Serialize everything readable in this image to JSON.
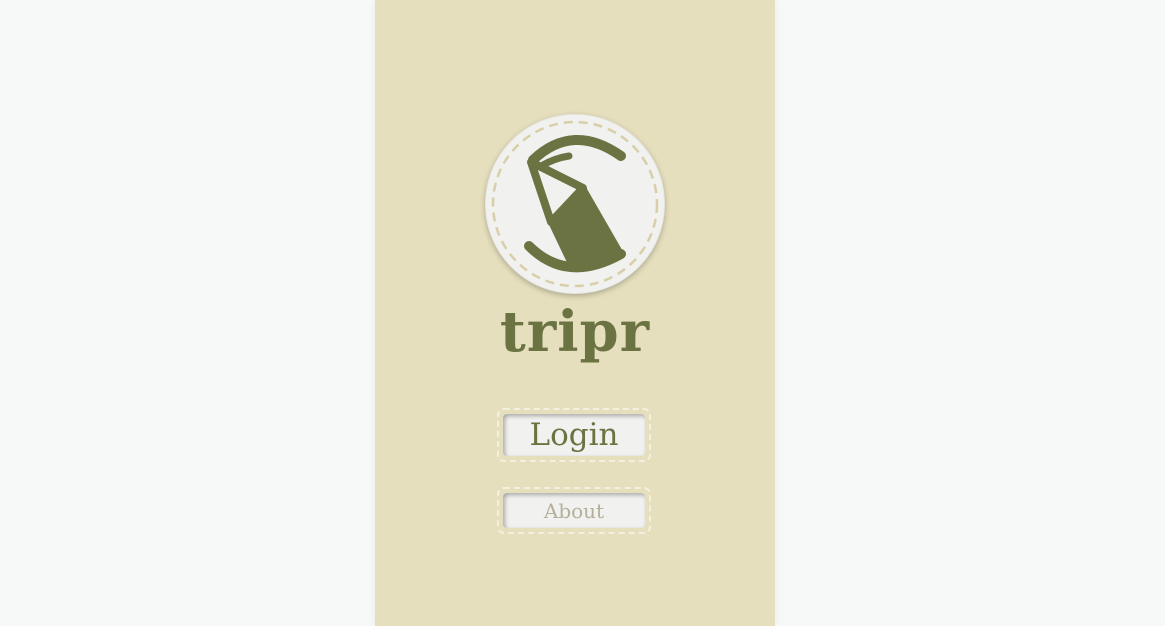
{
  "app": {
    "title": "tripr",
    "logo_icon": "folded-map-s-icon"
  },
  "buttons": {
    "login_label": "Login",
    "about_label": "About"
  },
  "colors": {
    "page_background": "#f7f8f8",
    "panel_background": "#e6dfbd",
    "brand_olive": "#6b7342",
    "badge_background": "#f1f1f0",
    "dashed_accent": "#d8cfa8",
    "login_text": "#6b7342",
    "about_text": "#b5b09a"
  }
}
